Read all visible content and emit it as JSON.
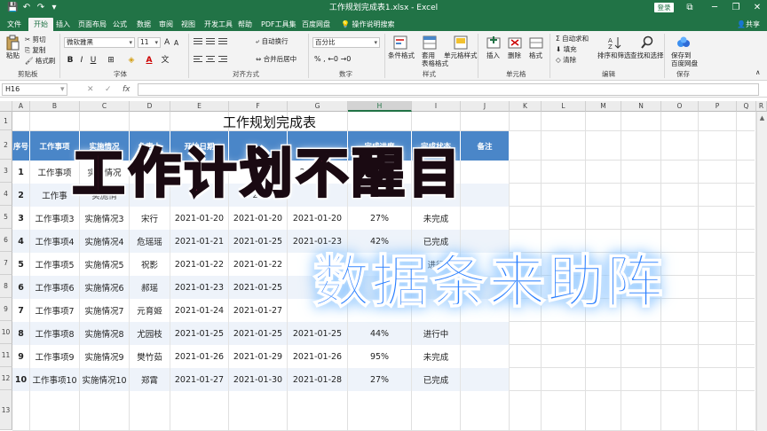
{
  "window": {
    "title": "工作规划完成表1.xlsx - Excel",
    "login_label": "登录",
    "share_label": "共享",
    "minimize": "─",
    "restore": "❐",
    "close": "✕",
    "ribbon_display": "⧉"
  },
  "quick_access": {
    "save": "💾",
    "undo": "↶",
    "redo": "↷",
    "more": "▾"
  },
  "tabs": [
    "文件",
    "开始",
    "插入",
    "页面布局",
    "公式",
    "数据",
    "审阅",
    "视图",
    "开发工具",
    "帮助",
    "PDF工具集",
    "百度网盘"
  ],
  "active_tab": "开始",
  "tell_me": "操作说明搜索",
  "ribbon": {
    "clipboard": {
      "paste": "粘贴",
      "cut": "剪切",
      "copy": "复制",
      "format_painter": "格式刷",
      "label": "剪贴板"
    },
    "font": {
      "name": "微软雅黑",
      "size": "11",
      "bold": "B",
      "italic": "I",
      "underline": "U",
      "font_color_a": "A",
      "label": "字体"
    },
    "alignment": {
      "wrap": "自动换行",
      "merge": "合并后居中",
      "label": "对齐方式"
    },
    "number": {
      "format": "百分比",
      "label": "数字"
    },
    "styles": {
      "conditional": "条件格式",
      "table_format": "套用\n表格格式",
      "cell_style": "单元格样式",
      "label": "样式"
    },
    "cells": {
      "insert": "插入",
      "delete": "删除",
      "format": "格式",
      "label": "单元格"
    },
    "editing": {
      "autosum": "自动求和",
      "fill": "填充",
      "clear": "清除",
      "sort_filter": "排序和筛选",
      "find_select": "查找和选择",
      "label": "编辑"
    },
    "save": {
      "save_to_baidu": "保存到\n百度网盘",
      "label": "保存"
    }
  },
  "formula_bar": {
    "name_box": "H16",
    "cancel": "✕",
    "enter": "✓",
    "fx": "fx"
  },
  "columns": [
    "A",
    "B",
    "C",
    "D",
    "E",
    "F",
    "G",
    "H",
    "I",
    "J",
    "K",
    "L",
    "M",
    "N",
    "O",
    "P",
    "Q",
    "R"
  ],
  "selected_column": "H",
  "rows": [
    "1",
    "2",
    "3",
    "4",
    "5",
    "6",
    "7",
    "8",
    "9",
    "10",
    "11",
    "12",
    "13"
  ],
  "sheet": {
    "title": "工作规划完成表",
    "headers": [
      "序号",
      "工作事项",
      "实施情况",
      "负责人",
      "开始日期",
      "",
      "",
      "完成进度",
      "完成状态",
      "备注"
    ],
    "records": [
      [
        "1",
        "工作事项",
        "实施情况",
        "",
        "",
        "",
        "2021-01",
        "",
        "",
        ""
      ],
      [
        "2",
        "工作事",
        "实施情",
        "",
        "",
        "20",
        "",
        "",
        "",
        ""
      ],
      [
        "3",
        "工作事项3",
        "实施情况3",
        "宋行",
        "2021-01-20",
        "2021-01-20",
        "2021-01-20",
        "27%",
        "未完成",
        ""
      ],
      [
        "4",
        "工作事项4",
        "实施情况4",
        "危瑶瑶",
        "2021-01-21",
        "2021-01-25",
        "2021-01-23",
        "42%",
        "已完成",
        ""
      ],
      [
        "5",
        "工作事项5",
        "实施情况5",
        "祝影",
        "2021-01-22",
        "2021-01-22",
        "",
        "",
        "进行",
        ""
      ],
      [
        "6",
        "工作事项6",
        "实施情况6",
        "郝瑶",
        "2021-01-23",
        "2021-01-25",
        "",
        "",
        "",
        ""
      ],
      [
        "7",
        "工作事项7",
        "实施情况7",
        "元育姬",
        "2021-01-24",
        "2021-01-27",
        "",
        "",
        "",
        ""
      ],
      [
        "8",
        "工作事项8",
        "实施情况8",
        "尤园枝",
        "2021-01-25",
        "2021-01-25",
        "2021-01-25",
        "44%",
        "进行中",
        ""
      ],
      [
        "9",
        "工作事项9",
        "实施情况9",
        "樊竹茹",
        "2021-01-26",
        "2021-01-29",
        "2021-01-26",
        "95%",
        "未完成",
        ""
      ],
      [
        "10",
        "工作事项10",
        "实施情况10",
        "郑霄",
        "2021-01-27",
        "2021-01-30",
        "2021-01-28",
        "27%",
        "已完成",
        ""
      ]
    ]
  },
  "overlay": {
    "headline": "工作计划不醒目",
    "subline": "数据条来助阵"
  },
  "colors": {
    "excel_green": "#217346",
    "header_blue": "#4a86c8",
    "stripe": "#eef3fa",
    "headline_pink": "#ff2d7e",
    "subline_blue": "#2a7fff"
  },
  "icons": {
    "paste": "clipboard-icon",
    "cut": "scissors-icon",
    "copy": "copy-icon",
    "painter": "brush-icon",
    "search": "lightbulb-icon",
    "share": "person-icon"
  }
}
